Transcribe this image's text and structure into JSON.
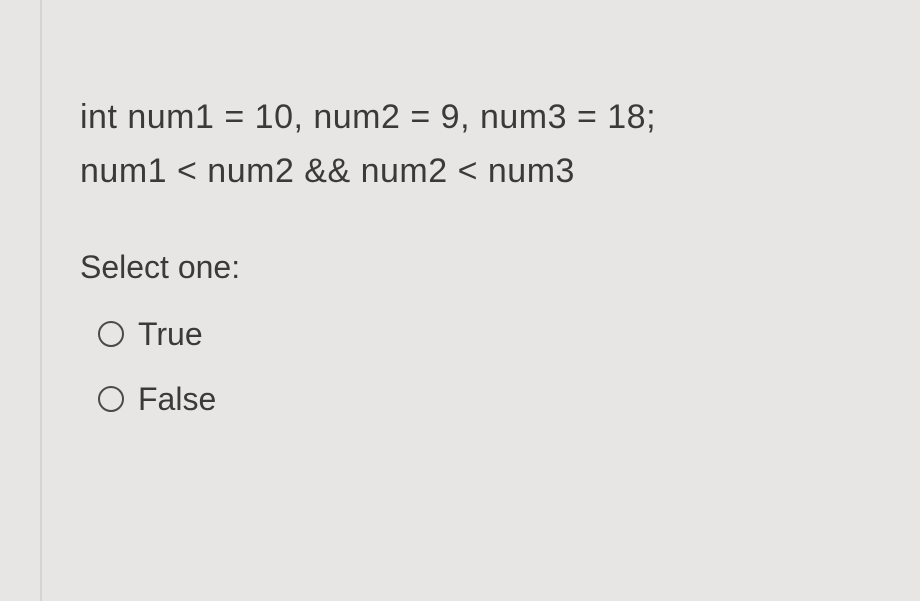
{
  "question": {
    "code_line1": "int num1 = 10, num2 = 9, num3 = 18;",
    "code_line2": "num1 < num2 && num2 < num3"
  },
  "prompt": "Select one:",
  "options": [
    {
      "label": "True"
    },
    {
      "label": "False"
    }
  ]
}
